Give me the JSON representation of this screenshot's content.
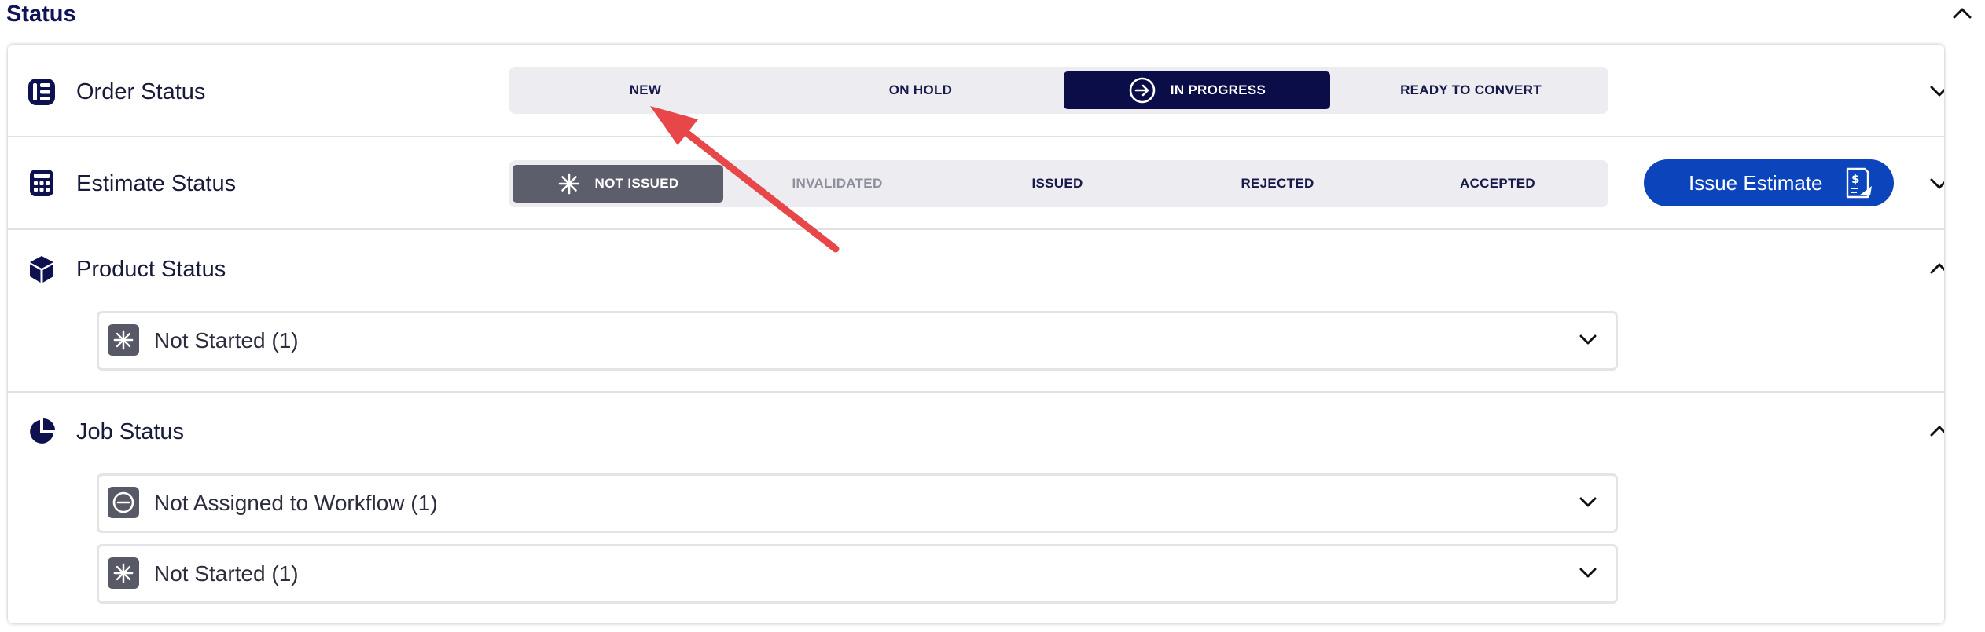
{
  "header": {
    "title": "Status"
  },
  "order_status": {
    "title": "Order Status",
    "steps": [
      {
        "label": "NEW",
        "state": "default"
      },
      {
        "label": "ON HOLD",
        "state": "default"
      },
      {
        "label": "IN PROGRESS",
        "state": "active"
      },
      {
        "label": "READY TO CONVERT",
        "state": "default"
      }
    ]
  },
  "estimate_status": {
    "title": "Estimate Status",
    "steps": [
      {
        "label": "NOT ISSUED",
        "state": "active"
      },
      {
        "label": "INVALIDATED",
        "state": "disabled"
      },
      {
        "label": "ISSUED",
        "state": "default"
      },
      {
        "label": "REJECTED",
        "state": "default"
      },
      {
        "label": "ACCEPTED",
        "state": "default"
      }
    ],
    "issue_button": "Issue Estimate"
  },
  "product_status": {
    "title": "Product Status",
    "items": [
      {
        "label": "Not Started (1)",
        "icon": "asterisk-icon"
      }
    ]
  },
  "job_status": {
    "title": "Job Status",
    "items": [
      {
        "label": "Not Assigned to Workflow (1)",
        "icon": "minus-circle-icon"
      },
      {
        "label": "Not Started (1)",
        "icon": "asterisk-icon"
      }
    ]
  },
  "colors": {
    "navy": "#0b0d48",
    "active_gray": "#5c5e6b",
    "button_blue": "#0b44bb",
    "segment_bg": "#ececf1",
    "annotation_arrow": "#e8474a"
  }
}
